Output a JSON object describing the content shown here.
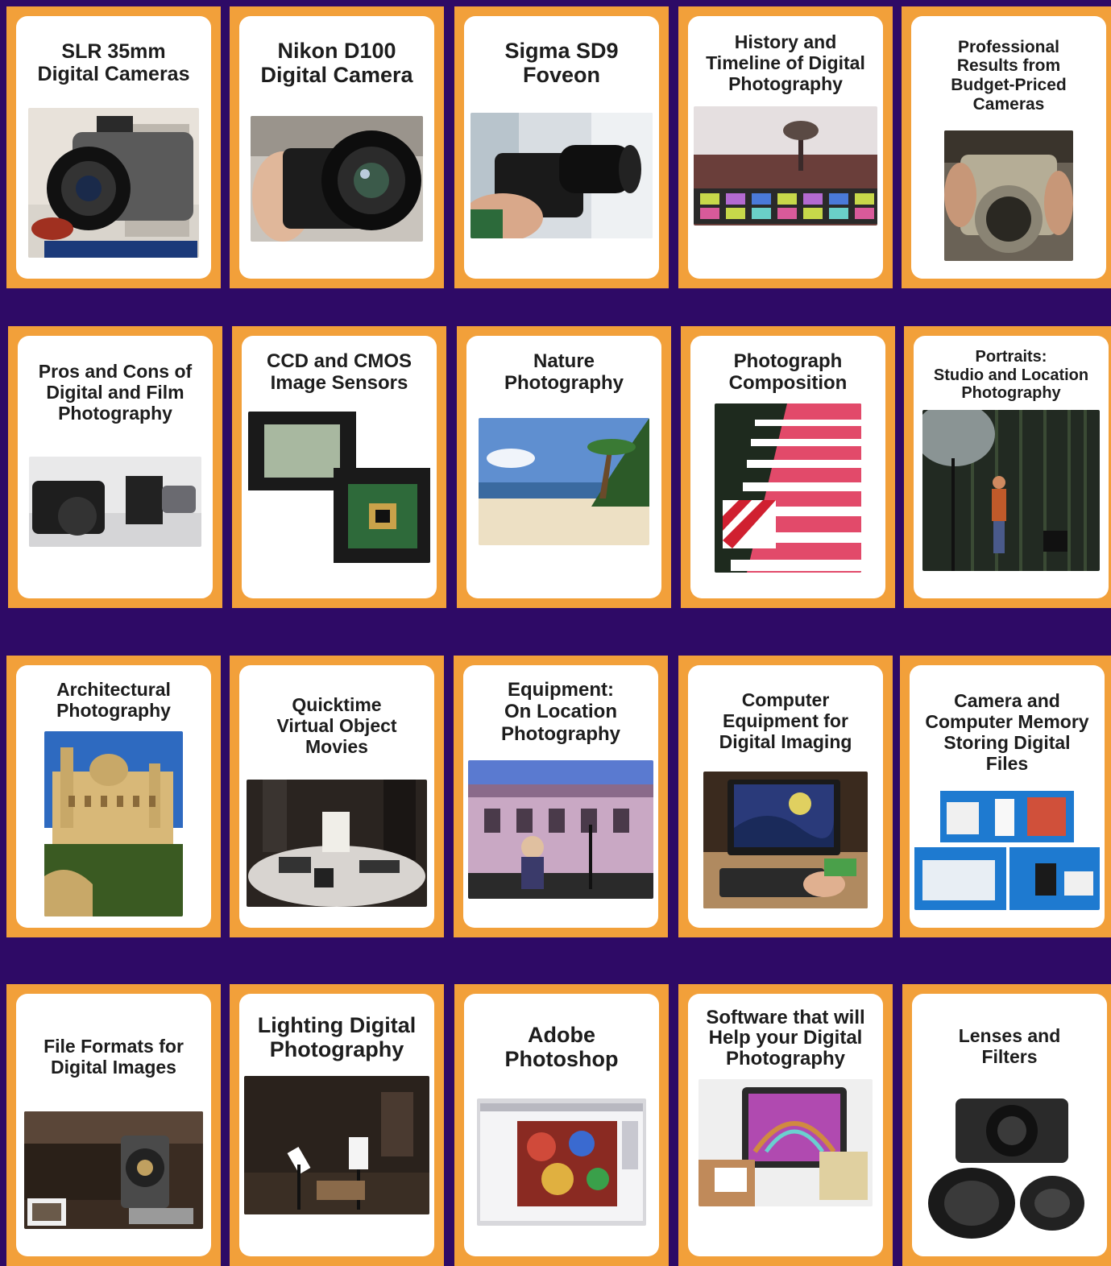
{
  "tiles": [
    {
      "id": "slr-35mm",
      "title": "SLR 35mm\nDigital Cameras",
      "icon": "slr-camera-photo"
    },
    {
      "id": "nikon-d100",
      "title": "Nikon D100\nDigital Camera",
      "icon": "nikon-camera-photo"
    },
    {
      "id": "sigma-sd9",
      "title": "Sigma SD9\nFoveon",
      "icon": "sigma-camera-photo"
    },
    {
      "id": "history",
      "title": "History and\nTimeline of Digital\nPhotography",
      "icon": "landscape-film-strip-photo"
    },
    {
      "id": "budget",
      "title": "Professional\nResults from\nBudget-Priced\nCameras",
      "icon": "compact-camera-photo"
    },
    {
      "id": "pros-cons",
      "title": "Pros and Cons of\nDigital and Film\nPhotography",
      "icon": "film-and-digital-cameras-photo"
    },
    {
      "id": "sensors",
      "title": "CCD and CMOS\nImage Sensors",
      "icon": "image-sensor-chip-photo"
    },
    {
      "id": "nature",
      "title": "Nature\nPhotography",
      "icon": "beach-palms-photo"
    },
    {
      "id": "composition",
      "title": "Photograph\nComposition",
      "icon": "striped-stairs-photo"
    },
    {
      "id": "portraits",
      "title": "Portraits:\nStudio and Location\nPhotography",
      "icon": "studio-portrait-photo"
    },
    {
      "id": "architectural",
      "title": "Architectural\nPhotography",
      "icon": "cathedral-photo"
    },
    {
      "id": "quicktime",
      "title": "Quicktime\nVirtual Object\nMovies",
      "icon": "turntable-objects-photo"
    },
    {
      "id": "equipment",
      "title": "Equipment:\nOn Location\nPhotography",
      "icon": "location-building-photo"
    },
    {
      "id": "computer",
      "title": "Computer\nEquipment for\nDigital Imaging",
      "icon": "computer-monitor-photo"
    },
    {
      "id": "memory",
      "title": "Camera and\nComputer Memory\nStoring Digital\nFiles",
      "icon": "memory-drives-photo"
    },
    {
      "id": "file-formats",
      "title": "File Formats for\nDigital Images",
      "icon": "steam-train-photo"
    },
    {
      "id": "lighting",
      "title": "Lighting Digital\nPhotography",
      "icon": "studio-lights-photo"
    },
    {
      "id": "photoshop",
      "title": "Adobe\nPhotoshop",
      "icon": "photoshop-screen-photo"
    },
    {
      "id": "software",
      "title": "Software that will\nHelp your Digital\nPhotography",
      "icon": "software-monitor-photo"
    },
    {
      "id": "lenses",
      "title": "Lenses and\nFilters",
      "icon": "lenses-filters-photo"
    }
  ]
}
